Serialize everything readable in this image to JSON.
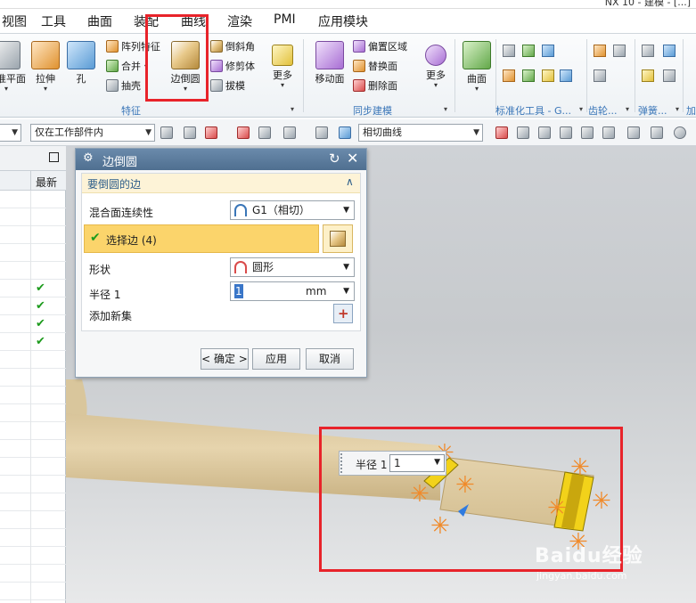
{
  "title_bar": {
    "text": "NX 10 - 建模 - [...]"
  },
  "menu": {
    "tabs": [
      "视图",
      "工具",
      "曲面",
      "装配",
      "曲线",
      "渲染",
      "PMI",
      "应用模块"
    ]
  },
  "ribbon": {
    "datum_plane": "基准平面",
    "extrude": "拉伸",
    "hole": "孔",
    "pattern_feature": "阵列特征",
    "unite": "合并",
    "shell": "抽壳",
    "edge_blend": "边倒圆",
    "chamfer": "倒斜角",
    "trim_body": "修剪体",
    "draft": "拔模",
    "more_1": "更多",
    "move_face": "移动面",
    "offset_region": "偏置区域",
    "replace_face": "替换面",
    "delete_face": "删除面",
    "more_2": "更多",
    "surface": "曲面",
    "group_feature": "特征",
    "group_sync": "同步建模",
    "group_standard": "标准化工具 - G...",
    "group_gear": "齿轮...",
    "group_spring": "弹簧...",
    "group_more": "加"
  },
  "toolbar2": {
    "scope_combo": "仅在工作部件内",
    "curve_rule_combo": "相切曲线"
  },
  "navigator": {
    "latest_header": "最新",
    "checks": [
      "✔",
      "✔",
      "✔",
      "✔"
    ]
  },
  "dialog": {
    "title": "边倒圆",
    "section_title": "要倒圆的边",
    "continuity_label": "混合面连续性",
    "continuity_value": "G1（相切）",
    "select_edge_label": "选择边 (4)",
    "shape_label": "形状",
    "shape_value": "圆形",
    "radius_label": "半径 1",
    "radius_value": "1",
    "radius_unit": "mm",
    "add_new_set_label": "添加新集",
    "ok_label": "< 确定 >",
    "apply_label": "应用",
    "cancel_label": "取消"
  },
  "floating_input": {
    "label": "半径 1",
    "value": "1"
  },
  "watermark": {
    "logo_text": "Baidu经验",
    "url": "jingyan.baidu.com"
  },
  "colors": {
    "highlight_red": "#e8232a",
    "selection_yellow": "#fbd46b",
    "check_green": "#1d9b1d",
    "part_tan": "#e2cfa3"
  }
}
